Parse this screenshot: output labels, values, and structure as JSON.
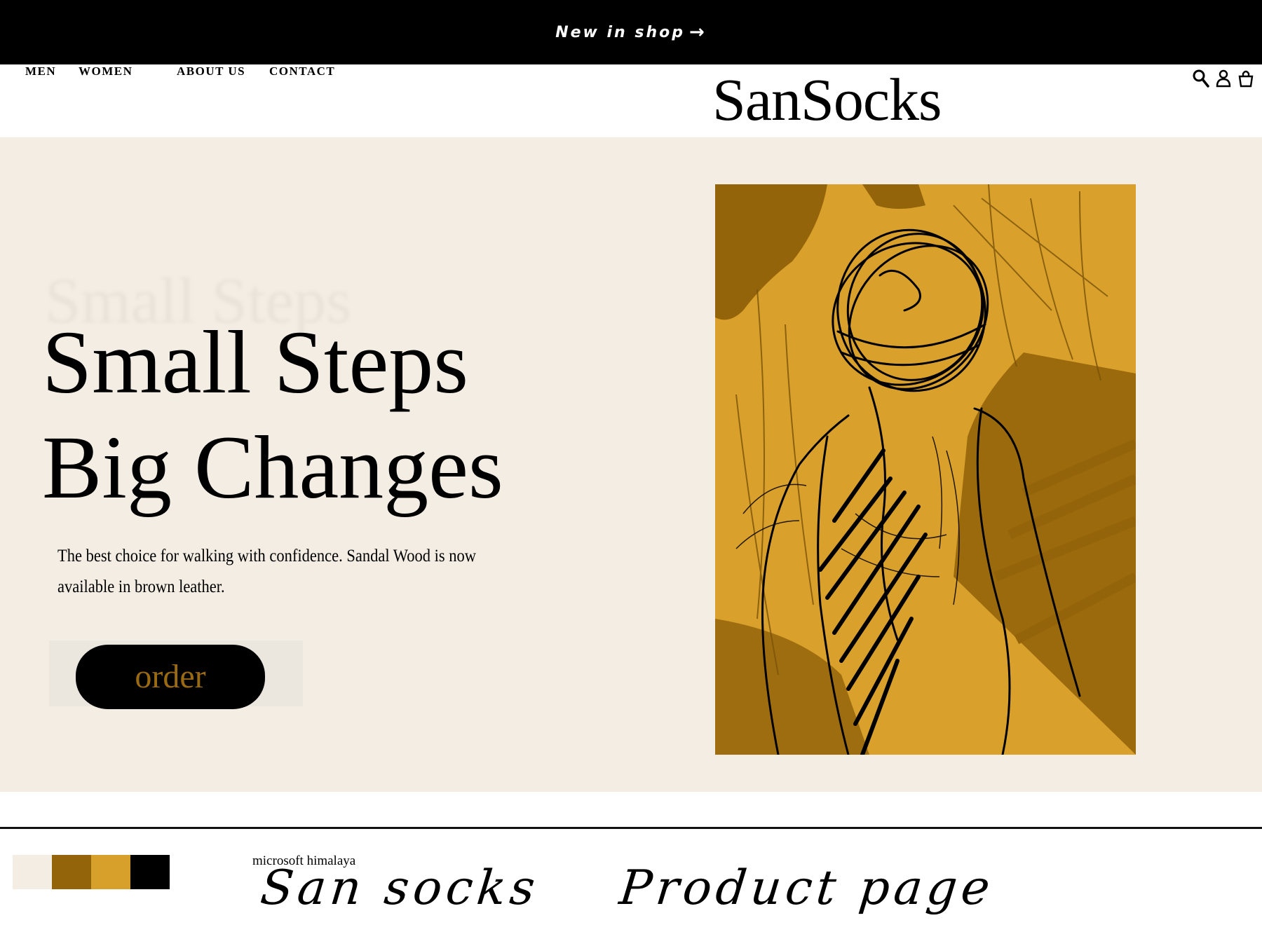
{
  "announcement": {
    "label": "New in shop",
    "arrow": "→"
  },
  "nav": {
    "items": [
      "Men",
      "Women",
      "About us",
      "Contact"
    ]
  },
  "brand": {
    "name": "SanSocks"
  },
  "header_icons": [
    "search-icon",
    "user-icon",
    "bag-icon"
  ],
  "hero": {
    "ghost_title": "Small Steps",
    "title_line1": "Small Steps",
    "title_line2": "Big Changes",
    "description": "The best choice for walking with confidence. Sandal Wood is now available in brown leather.",
    "cta_label": "order",
    "image_icon": "figure-sketch-illustration"
  },
  "notes": {
    "palette": [
      "#f3ede3",
      "#93640a",
      "#d7a02a",
      "#000000"
    ],
    "font_name": "microsoft himalaya",
    "hand_1": "San socks",
    "hand_2": "Product page"
  },
  "colors": {
    "cream": "#f3ede3",
    "mustard": "#d9a02c",
    "brown": "#93640a",
    "black": "#000000"
  }
}
